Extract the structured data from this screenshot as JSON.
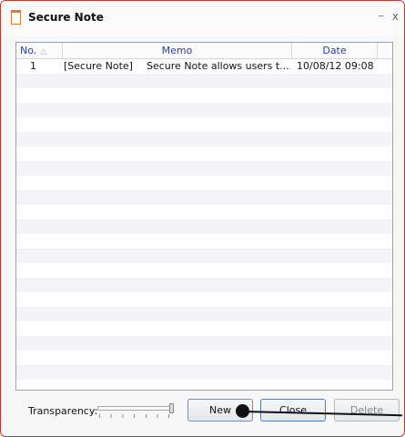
{
  "window": {
    "title": "Secure Note",
    "minimize_glyph": "–",
    "close_glyph": "x"
  },
  "list": {
    "columns": {
      "no": "No.",
      "sort_glyph": "△",
      "memo": "Memo",
      "date": "Date"
    },
    "rows": [
      {
        "no": "1",
        "tag": "[Secure Note]",
        "memo": "Secure Note allows users t...",
        "date": "10/08/12  09:08"
      }
    ]
  },
  "footer": {
    "transparency_label": "Transparency:",
    "transparency_level": 1.0,
    "buttons": {
      "new": "New",
      "close": "Close",
      "delete": "Delete"
    }
  },
  "colors": {
    "window_border": "#c2372e",
    "header_text": "#1f3fa8",
    "icon_accent": "#e07b2d"
  },
  "icons": {
    "title_icon": "note-icon"
  }
}
